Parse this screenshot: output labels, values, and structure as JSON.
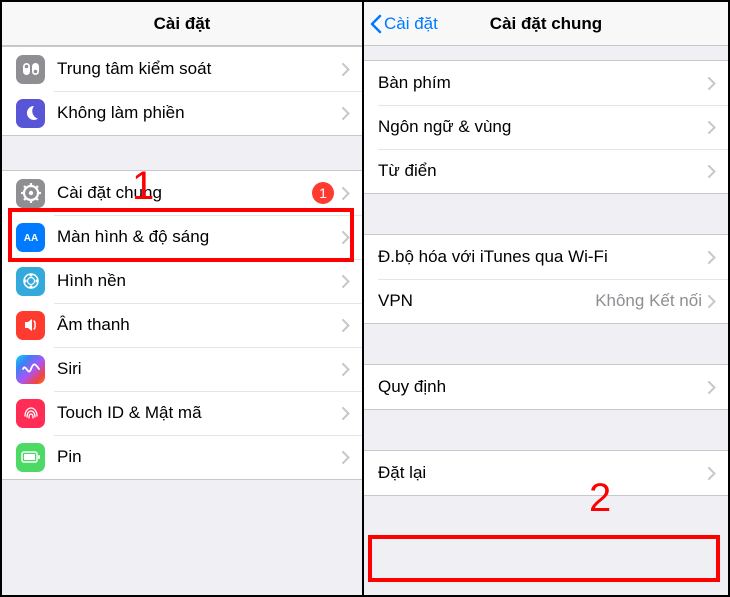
{
  "left": {
    "title": "Cài đặt",
    "annotation_number": "1",
    "rows_top": [
      {
        "label": "Trung tâm kiểm soát"
      },
      {
        "label": "Không làm phiền"
      }
    ],
    "general": {
      "label": "Cài đặt chung",
      "badge": "1"
    },
    "rows_mid": [
      {
        "label": "Màn hình & độ sáng"
      },
      {
        "label": "Hình nền"
      },
      {
        "label": "Âm thanh"
      },
      {
        "label": "Siri"
      },
      {
        "label": "Touch ID & Mật mã"
      },
      {
        "label": "Pin"
      }
    ]
  },
  "right": {
    "back_label": "Cài đặt",
    "title": "Cài đặt chung",
    "annotation_number": "2",
    "group1": [
      {
        "label": "Bàn phím"
      },
      {
        "label": "Ngôn ngữ & vùng"
      },
      {
        "label": "Từ điển"
      }
    ],
    "group2": [
      {
        "label": "Đ.bộ hóa với iTunes qua Wi-Fi"
      },
      {
        "label": "VPN",
        "detail": "Không Kết nối"
      }
    ],
    "group3": [
      {
        "label": "Quy định"
      }
    ],
    "group4": [
      {
        "label": "Đặt lại"
      }
    ]
  }
}
